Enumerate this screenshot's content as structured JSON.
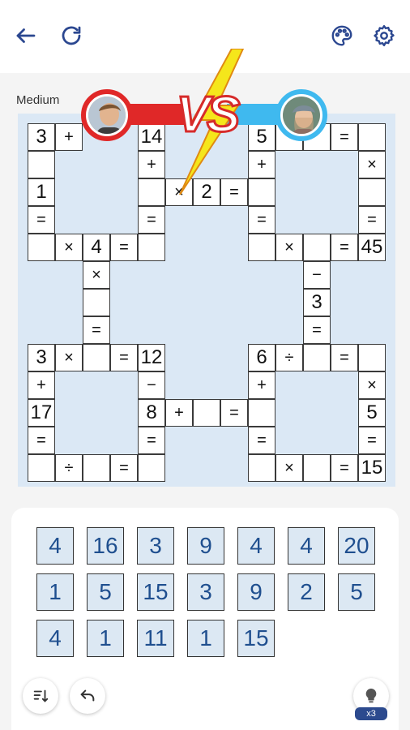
{
  "header": {
    "back_icon": "arrow-left-icon",
    "restart_icon": "refresh-icon",
    "theme_icon": "palette-icon",
    "settings_icon": "gear-icon"
  },
  "difficulty": "Medium",
  "versus": {
    "label": "VS",
    "left_color": "#e02828",
    "right_color": "#3fb9ef"
  },
  "board": {
    "r0": [
      "3",
      "+",
      "14",
      "5",
      "="
    ],
    "r1": [
      "+",
      "+",
      "×"
    ],
    "r2": [
      "1",
      "×",
      "2",
      "="
    ],
    "r3": [
      "=",
      "=",
      "=",
      "="
    ],
    "r4": [
      "×",
      "4",
      "=",
      "×",
      "=",
      "45"
    ],
    "r5": [
      "×",
      "−"
    ],
    "r6": [
      "3"
    ],
    "r7": [
      "=",
      "="
    ],
    "r8": [
      "3",
      "×",
      "=",
      "12",
      "6",
      "÷",
      "="
    ],
    "r9": [
      "+",
      "−",
      "+",
      "×"
    ],
    "r10": [
      "17",
      "8",
      "+",
      "=",
      "5"
    ],
    "r11": [
      "=",
      "=",
      "=",
      "="
    ],
    "r12": [
      "÷",
      "=",
      "×",
      "=",
      "15"
    ]
  },
  "tiles": [
    "4",
    "16",
    "3",
    "9",
    "4",
    "4",
    "20",
    "1",
    "5",
    "15",
    "3",
    "9",
    "2",
    "5",
    "4",
    "1",
    "11",
    "1",
    "15"
  ],
  "controls": {
    "sort_icon": "sort-icon",
    "undo_icon": "undo-icon",
    "hint_icon": "lightbulb-icon",
    "hint_count": "x3"
  }
}
